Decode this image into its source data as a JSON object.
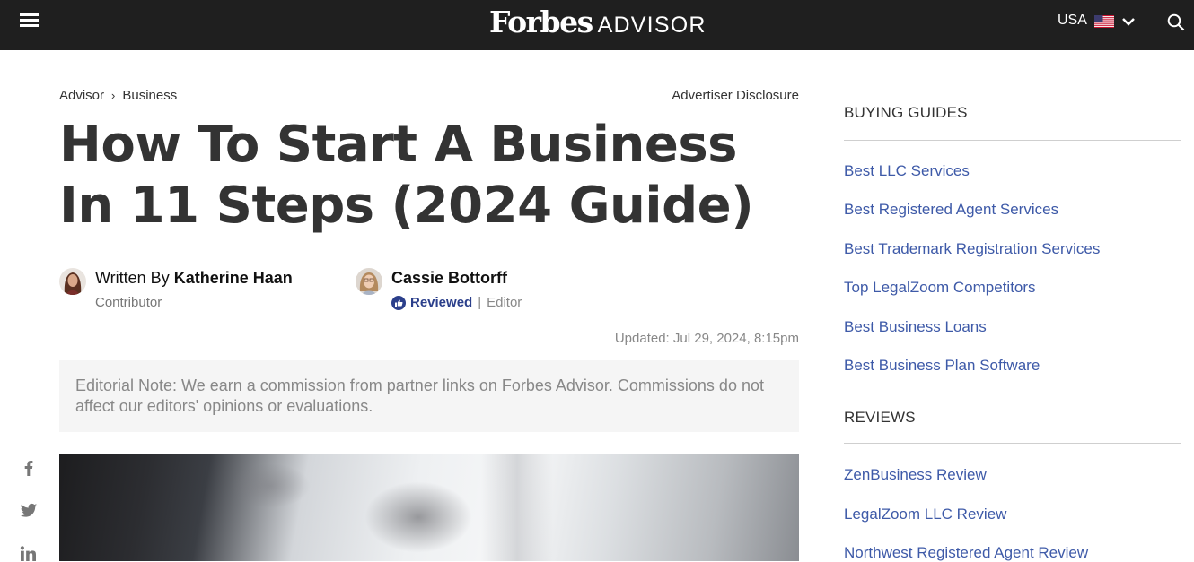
{
  "header": {
    "logo_forbes": "Forbes",
    "logo_advisor": "ADVISOR",
    "country": "USA"
  },
  "breadcrumb": {
    "items": [
      "Advisor",
      "Business"
    ],
    "separator": "›"
  },
  "disclosure": "Advertiser Disclosure",
  "article": {
    "title": "How To Start A Business In 11 Steps (2024 Guide)",
    "author_prefix": "Written By ",
    "author_name": "Katherine Haan",
    "author_role": "Contributor",
    "reviewer_name": "Cassie Bottorff",
    "reviewed_label": "Reviewed",
    "reviewer_sep": "|",
    "reviewer_role": "Editor",
    "updated": "Updated: Jul 29, 2024, 8:15pm",
    "editorial_note": "Editorial Note: We earn a commission from partner links on Forbes Advisor. Commissions do not affect our editors' opinions or evaluations."
  },
  "social": [
    "facebook-icon",
    "twitter-icon",
    "linkedin-icon"
  ],
  "sidebar": {
    "buying_guides_heading": "BUYING GUIDES",
    "buying_guides": [
      "Best LLC Services",
      "Best Registered Agent Services",
      "Best Trademark Registration Services",
      "Top LegalZoom Competitors",
      "Best Business Loans",
      "Best Business Plan Software"
    ],
    "reviews_heading": "REVIEWS",
    "reviews": [
      "ZenBusiness Review",
      "LegalZoom LLC Review",
      "Northwest Registered Agent Review"
    ]
  },
  "colors": {
    "topbar": "#1f1f1f",
    "link": "#3e5aa8",
    "reviewed": "#2b3f8b",
    "note_bg": "#f5f5f5"
  }
}
